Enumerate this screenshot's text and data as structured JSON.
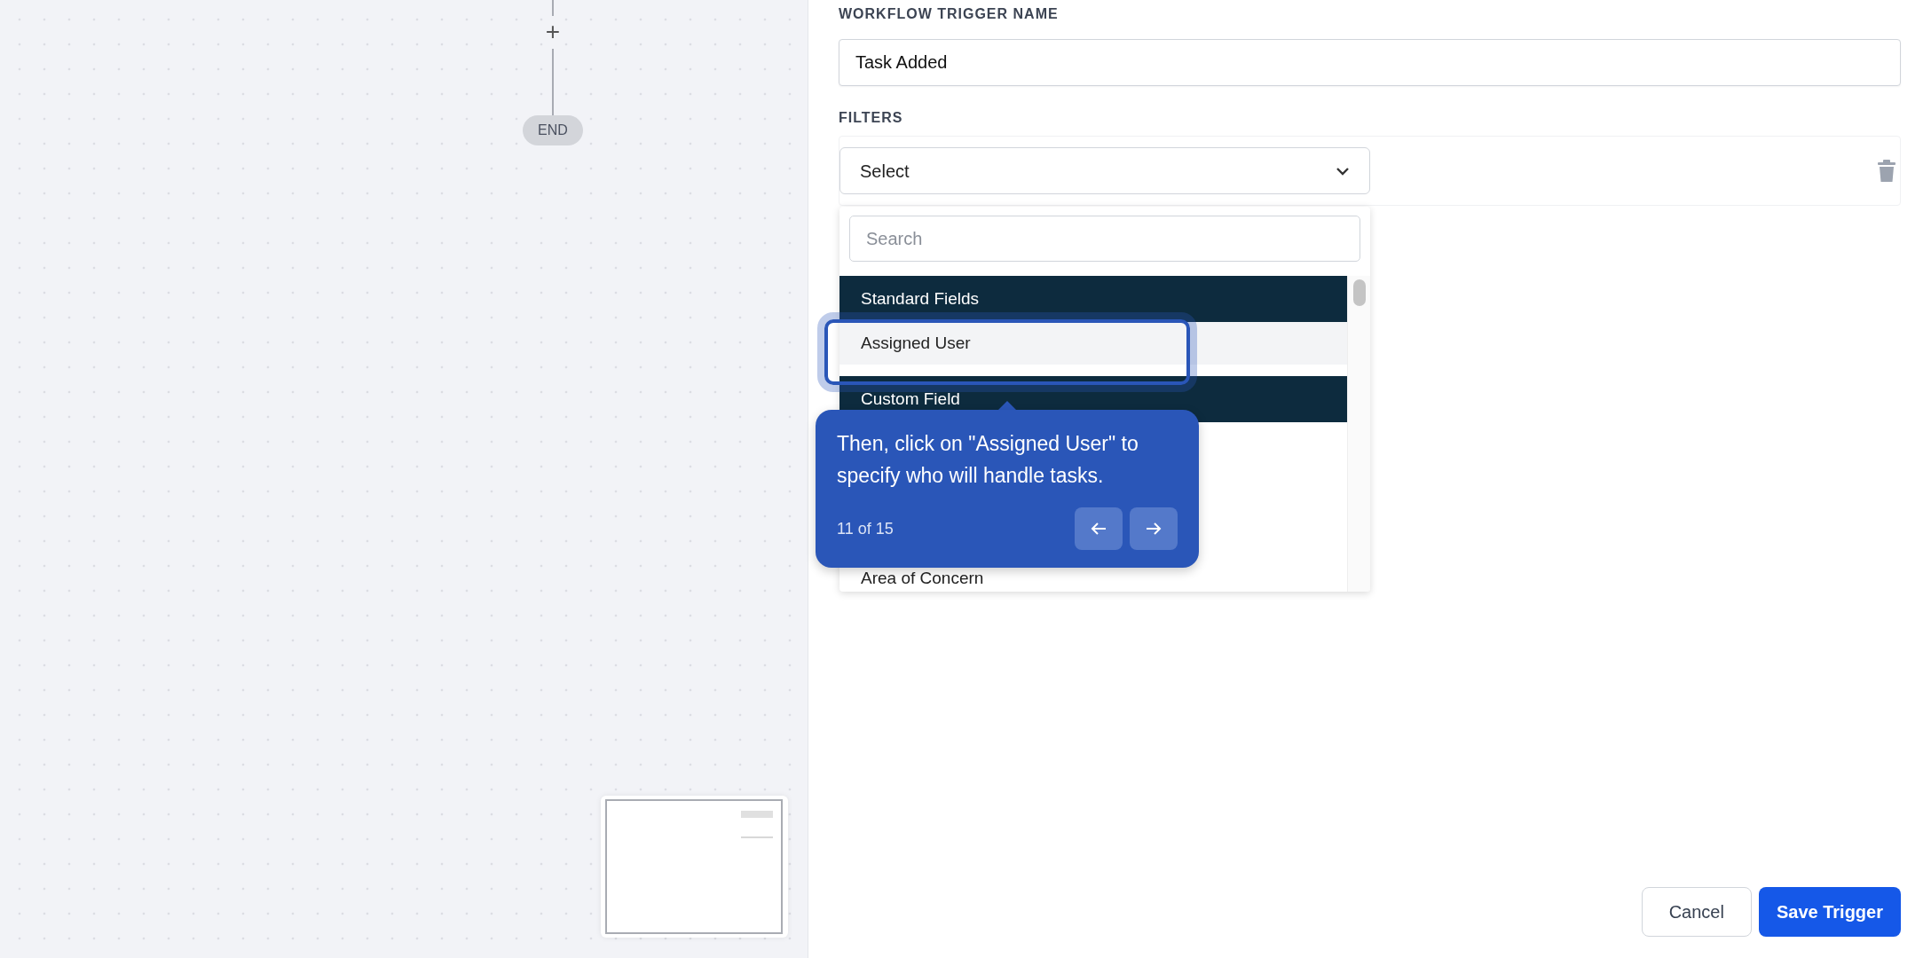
{
  "canvas": {
    "add_label": "+",
    "end_label": "END"
  },
  "form": {
    "name_label": "WORKFLOW TRIGGER NAME",
    "name_value": "Task Added",
    "filters_label": "FILTERS",
    "select_label": "Select"
  },
  "dropdown": {
    "search_placeholder": "Search",
    "items": [
      {
        "kind": "header",
        "label": "Standard Fields"
      },
      {
        "kind": "option",
        "label": "Assigned User",
        "highlighted": true
      },
      {
        "kind": "header",
        "label": "Custom Field"
      },
      {
        "kind": "gap"
      },
      {
        "kind": "option",
        "label": "Area of Concern",
        "highlighted": false
      }
    ]
  },
  "tooltip": {
    "text": "Then, click on \"Assigned User\" to specify who will handle tasks.",
    "step": "11 of 15"
  },
  "buttons": [
    {
      "kind": "secondary",
      "label": "Cancel"
    },
    {
      "kind": "primary",
      "label": "Save Trigger"
    }
  ]
}
